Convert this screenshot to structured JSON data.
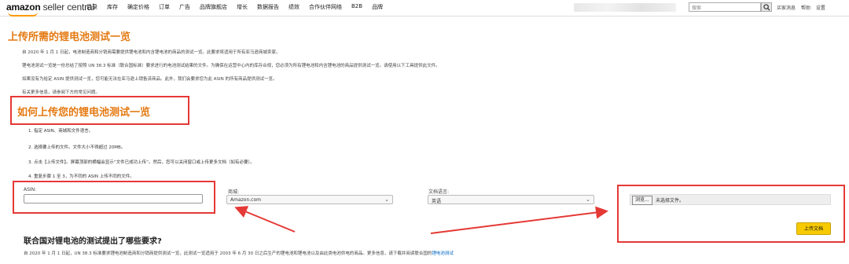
{
  "header": {
    "logo_main": "amazon",
    "logo_sub": "seller central",
    "nav": [
      "目录",
      "库存",
      "确定价格",
      "订单",
      "广告",
      "品牌旗舰店",
      "增长",
      "数据报告",
      "绩效",
      "合作伙伴网络",
      "B2B",
      "品牌"
    ],
    "search_placeholder": "搜索",
    "links": [
      "买家消息",
      "帮助",
      "设置"
    ]
  },
  "page": {
    "title": "上传所需的锂电池测试一览",
    "paragraphs": [
      "自 2020 年 1 月 1 日起，电池制造商和分销商需要提供锂电池和内含锂电池的商品的测试一览。此要求将适用于所有亚马逊商城卖家。",
      "锂电池测试一览是一份总结了按照 UN 38.3 标准（联合国标准）要求进行的电池测试结果的文件。为确保在运营中心内的库存合规，您必须为所有锂电池和内含锂电池的商品提供测试一览。请使用以下工具提供此文件。",
      "如果没有为给定 ASIN 提供测试一览，您可能无法在亚马逊上销售该商品。此外，我们会要求您为此 ASIN 的所有商品提供测试一览。",
      "有关更多信息，请参阅下方的常见问题。"
    ],
    "howto_title": "如何上传您的锂电池测试一览",
    "steps": [
      "1. 指定 ASIN、商城和文件语言。",
      "2. 选择要上传的文件。文件大小不得超过 20MB。",
      "3. 点击【上传文件】。屏幕顶部的横幅会显示“文件已成功上传”。然后，您可以关闭窗口或上传更多文档（如有必要）。",
      "4. 重复步骤 1 至 3，为不同的 ASIN 上传不同的文件。"
    ]
  },
  "form": {
    "asin_label": "ASIN:",
    "marketplace_label": "商城:",
    "marketplace_value": "Amazon.com",
    "language_label": "文档语言:",
    "language_value": "英语",
    "file_button": "浏览...",
    "file_status": "未选择文件。",
    "upload_button": "上传文档"
  },
  "faq": {
    "heading": "联合国对锂电池的测试提出了哪些要求?",
    "text": "自 2020 年 1 月 1 日起，UN 38.3 标准要求锂电池制造商和分销商提供测试一览，此测试一览适用于 2003 年 6 月 30 日之后生产的锂电池和锂电池以及由此类电池供电的商品。更多信息，请下载并阅读联合国的",
    "link": "锂电池测试"
  }
}
